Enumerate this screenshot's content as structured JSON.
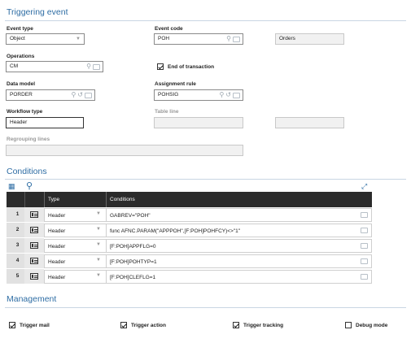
{
  "triggering": {
    "title": "Triggering event",
    "event_type": {
      "label": "Event type",
      "value": "Object"
    },
    "event_code": {
      "label": "Event code",
      "value": "POH",
      "description": "Orders"
    },
    "operations": {
      "label": "Operations",
      "value": "CM"
    },
    "end_of_transaction": {
      "label": "End of transaction",
      "checked": true
    },
    "data_model": {
      "label": "Data model",
      "value": "PORDER"
    },
    "assignment_rule": {
      "label": "Assignment rule",
      "value": "POHSIG"
    },
    "workflow_type": {
      "label": "Workflow type",
      "value": "Header"
    },
    "table_line": {
      "label": "Table line",
      "value": ""
    },
    "regrouping_lines": {
      "label": "Regrouping lines",
      "value": ""
    }
  },
  "conditions": {
    "title": "Conditions",
    "columns": [
      "Type",
      "Conditions"
    ],
    "rows": [
      {
        "num": "1",
        "type": "Header",
        "condition": "GABREV=\"POH\""
      },
      {
        "num": "2",
        "type": "Header",
        "condition": "func AFNC.PARAM(\"APPPOH\",[F:POH]POHFCY)<>\"1\""
      },
      {
        "num": "3",
        "type": "Header",
        "condition": "[F:POH]APPFLG=0"
      },
      {
        "num": "4",
        "type": "Header",
        "condition": "[F:POH]POHTYP=1"
      },
      {
        "num": "5",
        "type": "Header",
        "condition": "[F:POH]CLEFLG=1"
      }
    ]
  },
  "management": {
    "title": "Management",
    "trigger_mail": {
      "label": "Trigger mail",
      "checked": true
    },
    "trigger_action": {
      "label": "Trigger action",
      "checked": true
    },
    "trigger_tracking": {
      "label": "Trigger tracking",
      "checked": true
    },
    "debug_mode": {
      "label": "Debug mode",
      "checked": false
    }
  },
  "icons": {
    "lookup": "magnifier-icon",
    "detail": "detail-icon",
    "refresh": "refresh-icon",
    "expand": "expand-icon",
    "dropdown": "chevron-down-icon"
  },
  "colors": {
    "section_title": "#2e6da4",
    "grid_header": "#2b2b2b"
  }
}
